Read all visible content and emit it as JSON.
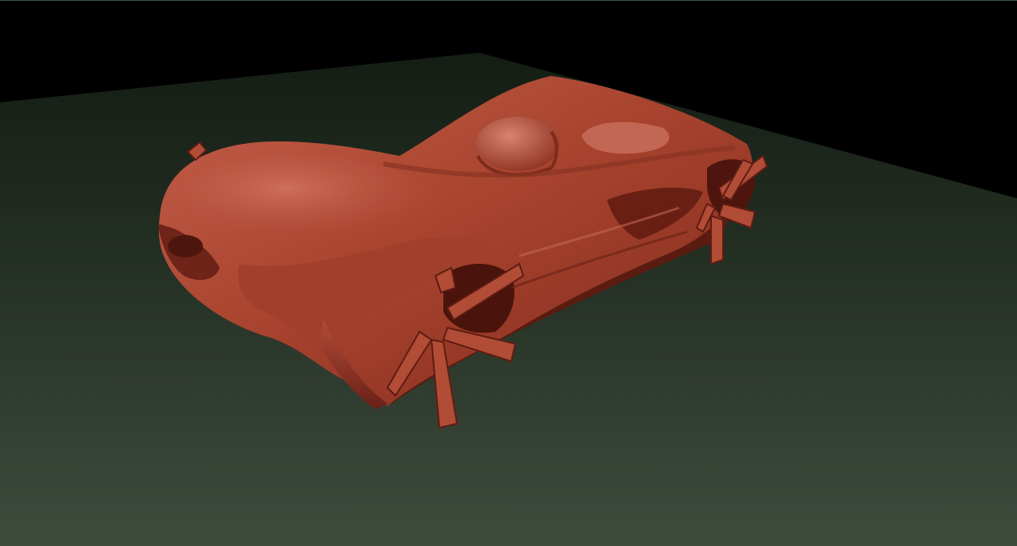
{
  "viewport": {
    "colors": {
      "background": "#000000",
      "floor_far": "#1a2419",
      "floor_near": "#3d4a3c",
      "model_base": "#a8402e",
      "model_light": "#c96450",
      "model_dark": "#5e1c12"
    },
    "scene_object": "sculpted-car-model"
  }
}
